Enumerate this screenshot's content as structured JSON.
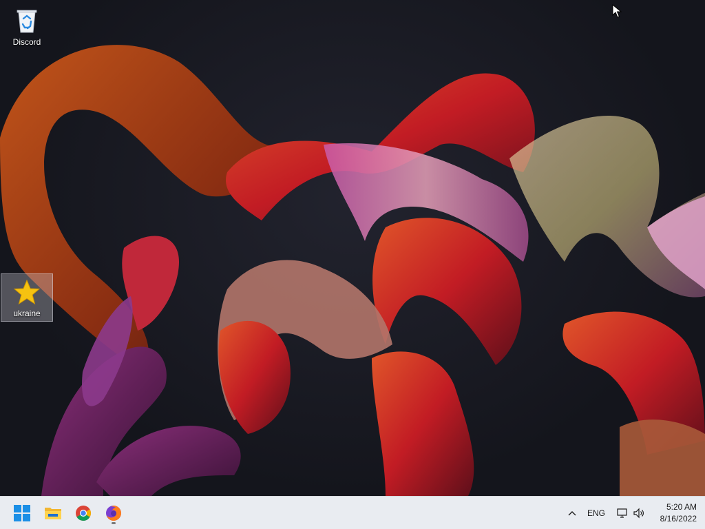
{
  "desktop": {
    "icons": [
      {
        "label": "Discord",
        "icon": "recycle-bin-icon"
      },
      {
        "label": "ukraine",
        "icon": "star-icon"
      }
    ]
  },
  "taskbar": {
    "apps": [
      {
        "name": "Start",
        "icon": "windows-start-icon"
      },
      {
        "name": "File Explorer",
        "icon": "folder-icon"
      },
      {
        "name": "Google Chrome",
        "icon": "chrome-icon"
      },
      {
        "name": "Firefox",
        "icon": "firefox-icon",
        "running": true
      }
    ],
    "tray": {
      "language": "ENG",
      "time": "5:20 AM",
      "date": "8/16/2022"
    }
  },
  "colors": {
    "taskbar_bg": "#e9ecf1",
    "desktop_bg": "#15161e",
    "selection": "#c8c8d2",
    "star": "#f5c211"
  }
}
